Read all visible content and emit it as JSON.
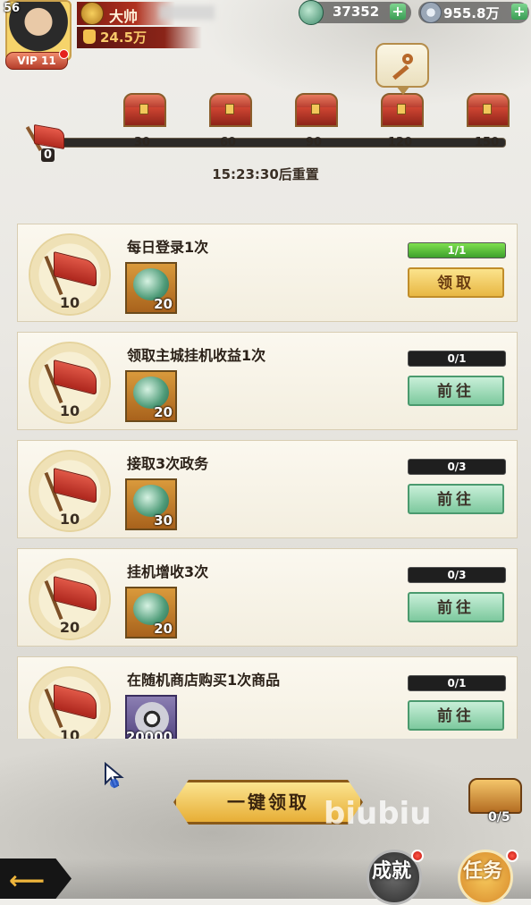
{
  "player": {
    "level": "56",
    "name": "大帅",
    "vip": "VIP 11",
    "power": "24.5万"
  },
  "resources": {
    "jade": "37352",
    "silver": "955.8万"
  },
  "progress": {
    "start": "0",
    "milestones": [
      "30",
      "60",
      "90",
      "120",
      "150"
    ],
    "current_value": 0,
    "reset_text": "15:23:30后重置"
  },
  "tasks": [
    {
      "title": "每日登录1次",
      "points": "10",
      "reward": "20",
      "reward_type": "jade",
      "progress": "1/1",
      "progress_fraction": 1.0,
      "button": "领取",
      "button_type": "claim"
    },
    {
      "title": "领取主城挂机收益1次",
      "points": "10",
      "reward": "20",
      "reward_type": "jade",
      "progress": "0/1",
      "progress_fraction": 0.0,
      "button": "前往",
      "button_type": "go"
    },
    {
      "title": "接取3次政务",
      "points": "10",
      "reward": "30",
      "reward_type": "jade",
      "progress": "0/3",
      "progress_fraction": 0.0,
      "button": "前往",
      "button_type": "go"
    },
    {
      "title": "挂机增收3次",
      "points": "20",
      "reward": "20",
      "reward_type": "jade",
      "progress": "0/3",
      "progress_fraction": 0.0,
      "button": "前往",
      "button_type": "go"
    },
    {
      "title": "在随机商店购买1次商品",
      "points": "10",
      "reward": "20000",
      "reward_type": "silver",
      "progress": "0/1",
      "progress_fraction": 0.0,
      "button": "前往",
      "button_type": "go"
    }
  ],
  "bottom": {
    "one_key_claim": "一键领取",
    "achievement_count": "0/5",
    "watermark": "biubiu",
    "tab_achievement": "成就",
    "tab_task": "任务"
  },
  "colors": {
    "claim_button": "#e8b743",
    "go_button": "#7dc99e",
    "progress_fill": "#3ea02c",
    "flag_red": "#b12a1f"
  },
  "icons": {
    "jade": "jade-icon",
    "silver": "silver-coin-icon",
    "flag": "red-flag-icon",
    "chest": "treasure-chest-icon",
    "key": "key-icon",
    "back": "back-arrow-icon"
  }
}
